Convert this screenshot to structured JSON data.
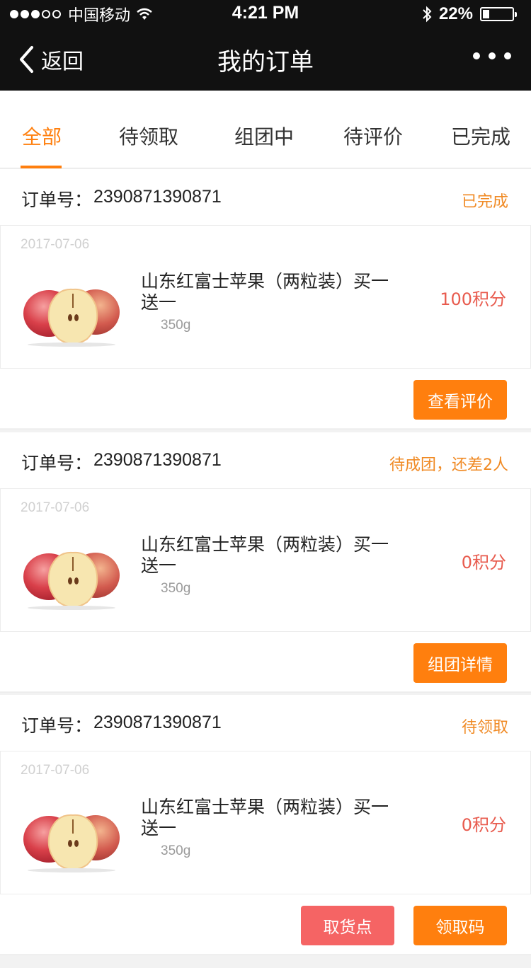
{
  "status_bar": {
    "carrier": "中国移动",
    "time": "4:21 PM",
    "battery_text": "22%",
    "battery_level": 0.22
  },
  "nav": {
    "back_label": "返回",
    "title": "我的订单"
  },
  "tabs": [
    {
      "label": "全部",
      "active": true
    },
    {
      "label": "待领取",
      "active": false
    },
    {
      "label": "组团中",
      "active": false
    },
    {
      "label": "待评价",
      "active": false
    },
    {
      "label": "已完成",
      "active": false
    }
  ],
  "order_no_label": "订单号：",
  "orders": [
    {
      "order_no": "2390871390871",
      "status": "已完成",
      "date": "2017-07-06",
      "product_name": "山东红富士苹果（两粒装）买一送一",
      "weight": "350g",
      "points": "100积分",
      "buttons": {
        "primary": "查看评价"
      }
    },
    {
      "order_no": "2390871390871",
      "status": "待成团，还差2人",
      "date": "2017-07-06",
      "product_name": "山东红富士苹果（两粒装）买一送一",
      "weight": "350g",
      "points": "0积分",
      "buttons": {
        "primary": "组团详情"
      }
    },
    {
      "order_no": "2390871390871",
      "status": "待领取",
      "date": "2017-07-06",
      "product_name": "山东红富士苹果（两粒装）买一送一",
      "weight": "350g",
      "points": "0积分",
      "buttons": {
        "secondary": "取货点",
        "primary": "领取码"
      }
    }
  ],
  "colors": {
    "accent": "#ff7f0e",
    "points": "#e85b4e",
    "secondary_button": "#f56464",
    "header_bg": "#111111"
  }
}
